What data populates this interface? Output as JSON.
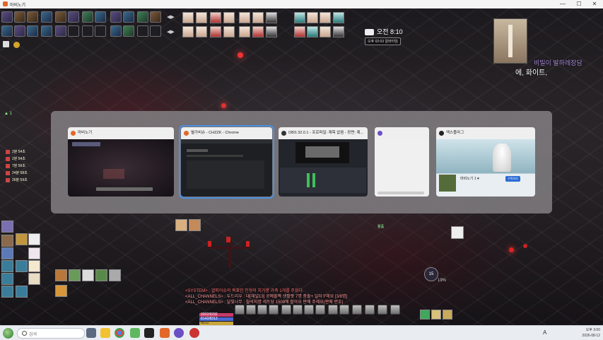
{
  "window": {
    "title": "마비노기",
    "minimize_icon": "—",
    "maximize_icon": "☐",
    "close_icon": "✕"
  },
  "hud": {
    "clock_time": "오전 8:10",
    "clock_sub": "오후 02:03 알바타임",
    "left_counter": "1",
    "buffs": [
      "2분 54초",
      "2분 54초",
      "7분 59초",
      "24분 58초",
      "26분 59초"
    ],
    "chat_right_1": "비밀이 발하레장담",
    "chat_right_2": "에, 화이트,",
    "level_badge": "15",
    "level_percent": "19%",
    "center_label": "물품"
  },
  "switcher": {
    "windows": [
      {
        "title": "마비노기",
        "fav_color": "#e2682a",
        "selected": false
      },
      {
        "title": "별가비슈 - CHZZK - Chrome",
        "fav_color": "#e2682a",
        "selected": true
      },
      {
        "title": "OBS 32.0.1 - 프로파일: 제목 없음 - 장면: 제...",
        "fav_color": "#333333",
        "selected": false
      },
      {
        "title": "",
        "fav_color": "#6b4fc4",
        "selected": false
      },
      {
        "title": "엑스플라그",
        "fav_color": "#222222",
        "selected": false
      }
    ],
    "stream_preview": {
      "name": "마비노기 1 ♥",
      "cta": "구독하기"
    }
  },
  "chat": [
    {
      "text": "<SYSTEM> : 엘피어슈의 목표인 인형의 치거봉 가축 1개를 주웠다.",
      "color": "#ff6e6e"
    },
    {
      "text": "<ALL_CHANNELS> : 두드리우 : 대[채널13] 공예물짝 생활팟 7명 충돌+ 일러구해요 [3/8명]",
      "color": "#ff9a9a"
    },
    {
      "text": "<ALL_CHANNELS> : 달빛나무 : 월석지명 세트당 1508에 팔아요 판매 주세요(판매 번호)",
      "color": "#ff9a9a"
    }
  ],
  "bars": {
    "hp": "9202/9292",
    "mp": "8142/8313",
    "sp": "NCG"
  },
  "taskbar": {
    "search_placeholder": "검색",
    "time": "오후 3:00",
    "date": "2026-08-12",
    "lang": "A"
  }
}
